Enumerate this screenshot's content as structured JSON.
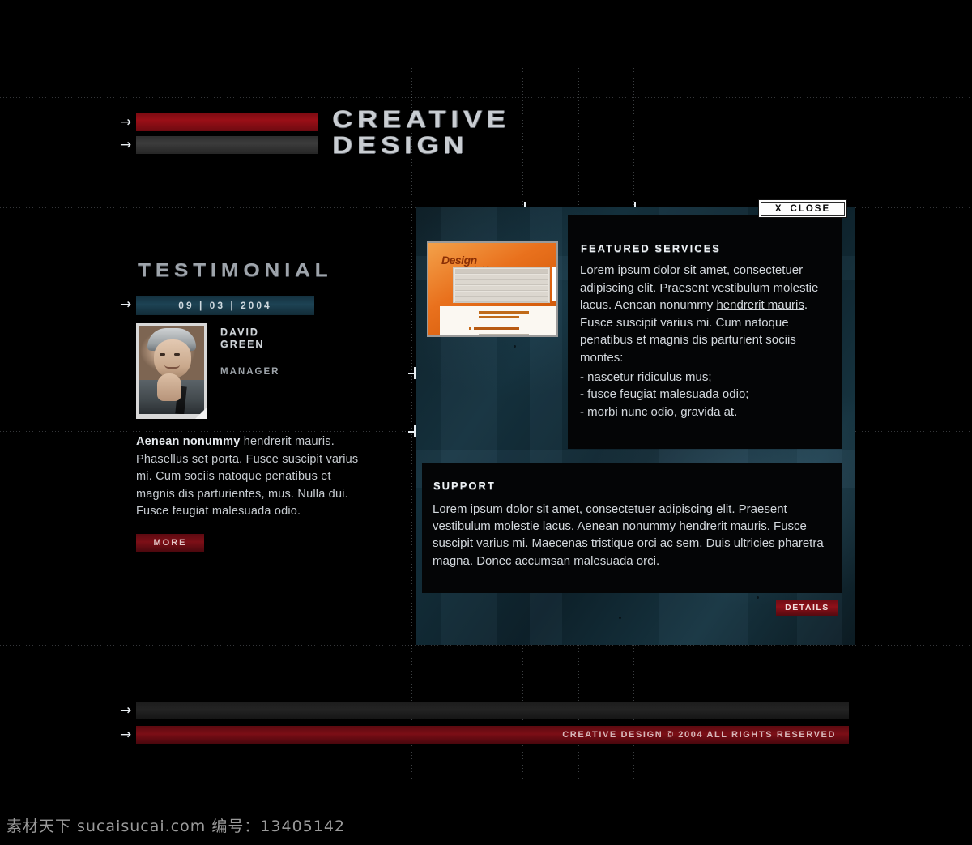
{
  "header": {
    "brand_line1": "CREATIVE",
    "brand_line2": "DESIGN",
    "arrow_icon": "→"
  },
  "testimonial": {
    "title": "TESTIMONIAL",
    "arrow_icon": "→",
    "date": "09 | 03 | 2004",
    "person_name_line1": "DAVID",
    "person_name_line2": "GREEN",
    "person_role": "MANAGER",
    "body_lead": "Aenean nonummy",
    "body_rest": " hendrerit mauris. Phasellus set porta. Fusce suscipit varius mi. Cum sociis natoque penatibus et magnis dis parturientes, mus. Nulla dui. Fusce feugiat malesuada odio.",
    "more_label": "MORE"
  },
  "featured": {
    "heading": "FEATURED SERVICES",
    "paragraph_before_link": "Lorem ipsum dolor sit amet, consectetuer adipiscing elit. Praesent vestibulum molestie lacus. Aenean nonummy ",
    "link_text": "hendrerit mauris",
    "paragraph_after_link": ". Fusce suscipit varius mi. Cum natoque penatibus et magnis dis parturient sociis montes:",
    "bullets": [
      "- nascetur ridiculus mus;",
      "- fusce feugiat malesuada odio;",
      "- morbi nunc odio, gravida at."
    ]
  },
  "close_button": {
    "x_label": "X",
    "label": "CLOSE"
  },
  "support": {
    "heading": "SUPPORT",
    "paragraph_before_link": "Lorem ipsum dolor sit amet, consectetuer adipiscing elit. Praesent vestibulum molestie lacus. Aenean nonummy hendrerit mauris. Fusce suscipit varius mi. Maecenas ",
    "link_text": "tristique orci ac sem",
    "paragraph_after_link": ". Duis ultricies pharetra magna. Donec accumsan malesuada orci.",
    "details_label": "DETAILS"
  },
  "thumbnail": {
    "logo": "Design",
    "logo_sub": "web design studio"
  },
  "footer": {
    "arrow_icon": "→",
    "copyright": "CREATIVE DESIGN © 2004  ALL RIGHTS RESERVED"
  },
  "watermark": {
    "text": "素材天下 sucaisucai.com  编号：13405142"
  },
  "colors": {
    "brand_red": "#7d0f17",
    "panel_teal": "#14303c",
    "accent_grey": "#3c3c3c",
    "card_black": "#040506",
    "text_light": "#d3d8dd"
  }
}
